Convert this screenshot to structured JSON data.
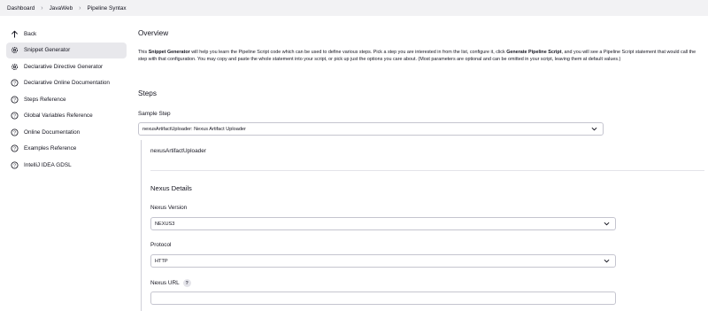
{
  "breadcrumb": [
    "Dashboard",
    "JavaWeb",
    "Pipeline Syntax"
  ],
  "sidebar": {
    "items": [
      {
        "label": "Back",
        "icon": "arrow-up-icon",
        "active": false
      },
      {
        "label": "Snippet Generator",
        "icon": "gear-icon",
        "active": true
      },
      {
        "label": "Declarative Directive Generator",
        "icon": "gear-icon",
        "active": false
      },
      {
        "label": "Declarative Online Documentation",
        "icon": "help-circle-icon",
        "active": false
      },
      {
        "label": "Steps Reference",
        "icon": "help-circle-icon",
        "active": false
      },
      {
        "label": "Global Variables Reference",
        "icon": "help-circle-icon",
        "active": false
      },
      {
        "label": "Online Documentation",
        "icon": "help-circle-icon",
        "active": false
      },
      {
        "label": "Examples Reference",
        "icon": "help-circle-icon",
        "active": false
      },
      {
        "label": "IntelliJ IDEA GDSL",
        "icon": "help-circle-icon",
        "active": false
      }
    ]
  },
  "overview": {
    "title": "Overview",
    "text_1": "This ",
    "bold_1": "Snippet Generator",
    "text_2": " will help you learn the Pipeline Script code which can be used to define various steps. Pick a step you are interested in from the list, configure it, click ",
    "bold_2": "Generate Pipeline Script",
    "text_3": ", and you will see a Pipeline Script statement that would call the step with that configuration. You may copy and paste the whole statement into your script, or pick up just the options you care about. (Most parameters are optional and can be omitted in your script, leaving them at default values.)"
  },
  "steps": {
    "title": "Steps",
    "sample_step_label": "Sample Step",
    "sample_step_value": "nexusArtifactUploader: Nexus Artifact Uploader",
    "step_name": "nexusArtifactUploader"
  },
  "nexus": {
    "title": "Nexus Details",
    "version_label": "Nexus Version",
    "version_value": "NEXUS3",
    "protocol_label": "Protocol",
    "protocol_value": "HTTP",
    "url_label": "Nexus URL",
    "url_help": "?",
    "url_value": ""
  }
}
